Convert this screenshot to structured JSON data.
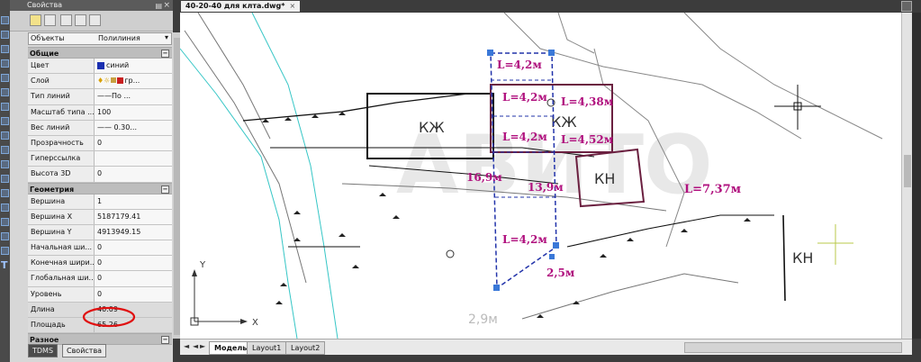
{
  "properties_panel": {
    "title": "Свойства",
    "object_label": "Объекты",
    "object_value": "Полилиния",
    "sections": {
      "general": "Общие",
      "geometry": "Геометрия",
      "misc": "Разное"
    },
    "general_rows": [
      {
        "key": "Цвет",
        "value": "синий"
      },
      {
        "key": "Слой",
        "value": "гр..."
      },
      {
        "key": "Тип линий",
        "value": "——По ..."
      },
      {
        "key": "Масштаб типа ...",
        "value": "100"
      },
      {
        "key": "Вес линий",
        "value": "—— 0.30..."
      },
      {
        "key": "Прозрачность",
        "value": "0"
      },
      {
        "key": "Гиперссылка",
        "value": ""
      },
      {
        "key": "Высота 3D",
        "value": "0"
      }
    ],
    "geometry_rows": [
      {
        "key": "Вершина",
        "value": "1"
      },
      {
        "key": "Вершина X",
        "value": "5187179.41"
      },
      {
        "key": "Вершина Y",
        "value": "4913949.15"
      },
      {
        "key": "Начальная ши...",
        "value": "0"
      },
      {
        "key": "Конечная шири...",
        "value": "0"
      },
      {
        "key": "Глобальная ши...",
        "value": "0"
      },
      {
        "key": "Уровень",
        "value": "0"
      },
      {
        "key": "Длина",
        "value": "40.09"
      },
      {
        "key": "Площадь",
        "value": "65.26"
      }
    ],
    "tabs": [
      "TDMS",
      "Свойства"
    ],
    "color_swatch": "#1a2fb0",
    "layer_swatch": "#c81e1e"
  },
  "document": {
    "tab_title": "40-20-40 для клта.dwg*",
    "layout_tabs": [
      "Модель",
      "Layout1",
      "Layout2"
    ]
  },
  "drawing": {
    "buildings": [
      "КЖ",
      "КЖ",
      "КН",
      "КН"
    ],
    "dimensions": [
      "L=4,2м",
      "L=4,2м",
      "L=4,38м",
      "L=4,2м",
      "L=4,52м",
      "16,9м",
      "13,9м",
      "L=7,37м",
      "L=4,2м",
      "2,5м",
      "2,9м"
    ],
    "ucs": {
      "x": "X",
      "y": "Y"
    },
    "label_color": "#b0107e",
    "polyline_color": "#2233aa"
  }
}
